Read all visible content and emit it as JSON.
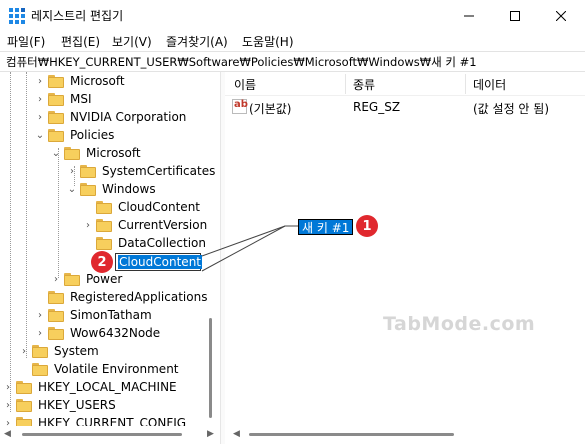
{
  "window": {
    "title": "레지스트리 편집기",
    "controls": {
      "minimize": "minimize",
      "maximize": "maximize",
      "close": "close"
    }
  },
  "menu": [
    "파일(F)",
    "편집(E)",
    "보기(V)",
    "즐겨찾기(A)",
    "도움말(H)"
  ],
  "address": "컴퓨터₩HKEY_CURRENT_USER₩Software₩Policies₩Microsoft₩Windows₩새 키 #1",
  "tree": {
    "items": [
      "Microsoft",
      "MSI",
      "NVIDIA Corporation",
      "Policies",
      "Microsoft",
      "SystemCertificates",
      "Windows",
      "CloudContent",
      "CurrentVersion",
      "DataCollection",
      "CloudContent",
      "Power",
      "RegisteredApplications",
      "SimonTatham",
      "Wow6432Node",
      "System",
      "Volatile Environment",
      "HKEY_LOCAL_MACHINE",
      "HKEY_USERS",
      "HKEY_CURRENT_CONFIG"
    ]
  },
  "list": {
    "headers": {
      "name": "이름",
      "type": "종류",
      "data": "데이터"
    },
    "rows": [
      {
        "name": "(기본값)",
        "type": "REG_SZ",
        "data": "(값 설정 안 됨)"
      }
    ]
  },
  "new_key_label": "새 키 #1",
  "annotations": {
    "badge1": "1",
    "badge2": "2"
  },
  "watermark": "TabMode.com",
  "colors": {
    "selection": "#0078d7",
    "badge": "#e0282e",
    "folder": "#f7cf5d"
  }
}
